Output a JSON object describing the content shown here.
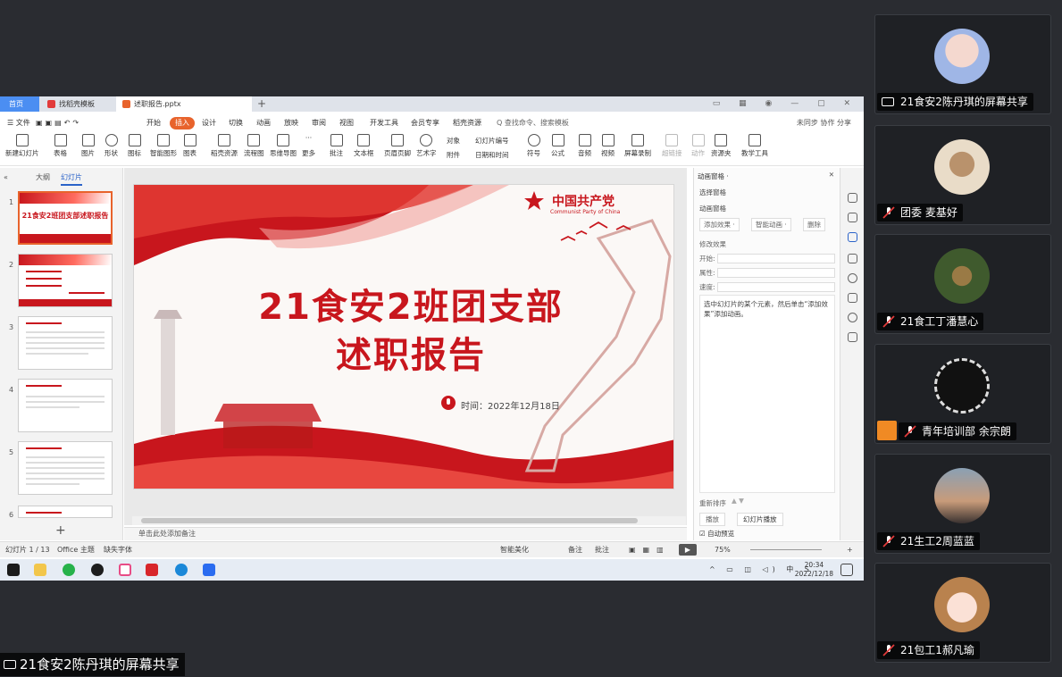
{
  "colors": {
    "accent": "#e8632c",
    "party_red": "#c8161d",
    "tab_blue": "#4b8ef2"
  },
  "tabs": [
    {
      "label": "首页",
      "icon": ""
    },
    {
      "label": "找稻壳模板",
      "icon": "docer-icon"
    },
    {
      "label": "述职报告.pptx",
      "icon": "ppt-file-icon"
    }
  ],
  "menu": {
    "file": "☰ 文件",
    "items": [
      "开始",
      "插入",
      "设计",
      "切换",
      "动画",
      "放映",
      "审阅",
      "视图",
      "开发工具",
      "会员专享",
      "稻壳资源"
    ],
    "active": "插入",
    "search": "Q 查找命令、搜索模板",
    "right": "未同步  协作  分享"
  },
  "ribbon": [
    "新建幻灯片",
    "表格",
    "图片",
    "形状",
    "图标",
    "智能图形",
    "图表",
    "稻壳资源",
    "流程图",
    "思维导图",
    "更多",
    "批注",
    "文本框",
    "页眉页脚",
    "艺术字",
    "对象",
    "附件",
    "幻灯片编号",
    "日期和时间",
    "符号",
    "公式",
    "音频",
    "视频",
    "屏幕录制",
    "超链接",
    "动作",
    "资源夹",
    "教学工具"
  ],
  "panel": {
    "tab_outline": "大纲",
    "tab_slides": "幻灯片",
    "thumb_title": "21食安2班团支部述职报告",
    "thumb_nums": [
      "1",
      "2",
      "3",
      "4",
      "5",
      "6"
    ]
  },
  "slide": {
    "title_line1": "21食安2班团支部",
    "title_line2": "述职报告",
    "party_name": "中国共产党",
    "party_en": "Communist Party of China",
    "date_text": "时间：2022年12月18日"
  },
  "notes_placeholder": "单击此处添加备注",
  "anim_pane": {
    "header": "动画窗格 ·",
    "select_pane": "选择窗格",
    "custom_anim": "动画窗格",
    "add_effect": "添加效果 ·",
    "smart_anim": "智能动画 ·",
    "delete": "删除",
    "modify": "修改效果",
    "start": "开始:",
    "property": "属性:",
    "speed": "速度:",
    "hint": "选中幻灯片的某个元素，然后单击“添加效果”添加动画。",
    "reorder": "重新排序",
    "play": "播放",
    "slideshow": "幻灯片播放",
    "autopreview": "自动预览"
  },
  "status": {
    "slide_count": "幻灯片 1 / 13",
    "theme": "Office 主题",
    "missing_font": "缺失字体",
    "smart_beautify": "智能美化",
    "notes": "备注",
    "comments": "批注",
    "zoom": "75%"
  },
  "taskbar": {
    "time": "20:34",
    "date": "2022/12/18",
    "ime": "中"
  },
  "participants": [
    {
      "name": "21食安2陈丹琪的屏幕共享",
      "type": "share"
    },
    {
      "name": "团委 麦基好",
      "type": "muted"
    },
    {
      "name": "21食工丁潘慧心",
      "type": "muted"
    },
    {
      "name": "青年培训部 余宗朗",
      "type": "muted-badge"
    },
    {
      "name": "21生工2周蓝蓝",
      "type": "muted"
    },
    {
      "name": "21包工1郝凡瑜",
      "type": "muted"
    }
  ],
  "share_label": "21食安2陈丹琪的屏幕共享"
}
